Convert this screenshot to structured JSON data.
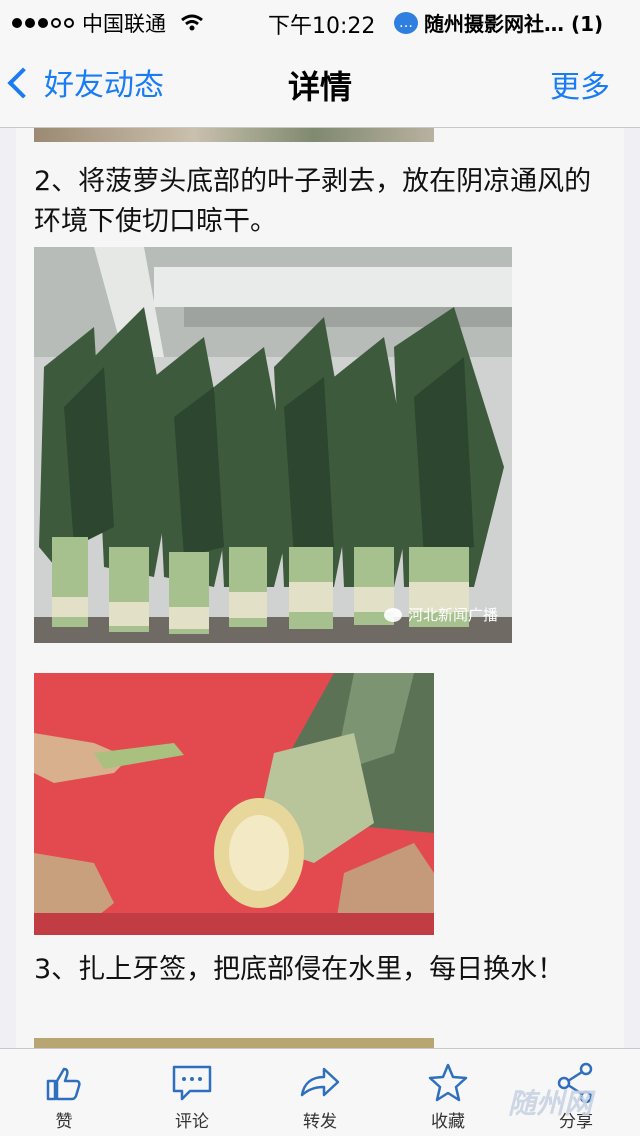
{
  "status_bar": {
    "carrier": "中国联通",
    "time": "下午10:22",
    "notice": "随州摄影网社… (1)"
  },
  "nav": {
    "back_label": "好友动态",
    "title": "详情",
    "more_label": "更多"
  },
  "article": {
    "step2": "2、将菠萝头底部的叶子剥去，放在阴凉通风的环境下使切口晾干。",
    "step3": "3、扎上牙签，把底部侵在水里，每日换水！",
    "watermark": "河北新闻广播"
  },
  "tabs": [
    {
      "label": "赞",
      "icon": "thumbs-up-icon"
    },
    {
      "label": "评论",
      "icon": "comment-icon"
    },
    {
      "label": "转发",
      "icon": "forward-icon"
    },
    {
      "label": "收藏",
      "icon": "star-icon"
    },
    {
      "label": "分享",
      "icon": "share-icon"
    }
  ],
  "corner_watermark": "随州网",
  "colors": {
    "accent": "#1a7cf4",
    "tab_icon": "#2f6fbd"
  }
}
